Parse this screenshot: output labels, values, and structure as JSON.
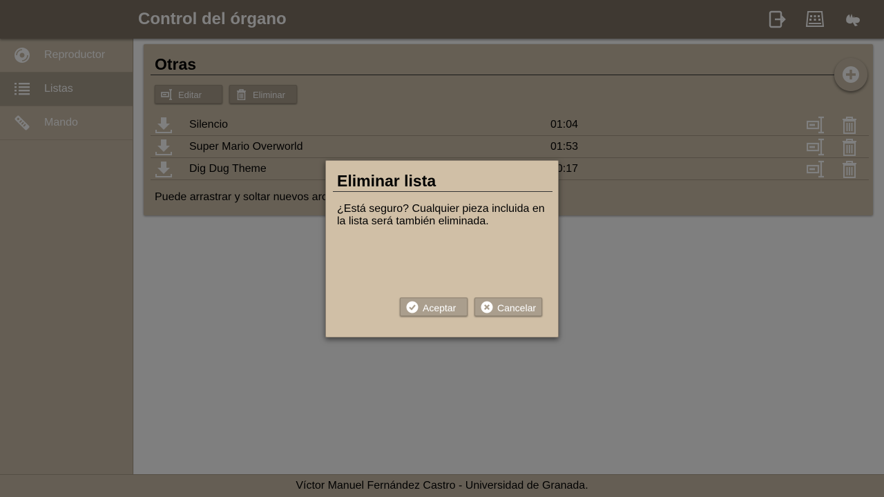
{
  "header": {
    "title": "Control del órgano",
    "icons": [
      "logout-icon",
      "keyboard-icon",
      "sign-language-icon"
    ]
  },
  "sidebar": {
    "items": [
      {
        "label": "Reproductor",
        "icon": "disc-icon"
      },
      {
        "label": "Listas",
        "icon": "list-icon",
        "active": true
      },
      {
        "label": "Mando",
        "icon": "remote-control-icon"
      }
    ]
  },
  "playlist": {
    "title": "Otras",
    "edit_label": "Editar",
    "delete_label": "Eliminar",
    "tracks": [
      {
        "name": "Silencio",
        "duration": "01:04"
      },
      {
        "name": "Super Mario Overworld",
        "duration": "01:53"
      },
      {
        "name": "Dig Dug Theme",
        "duration": "00:17"
      }
    ],
    "hint": "Puede arrastrar y soltar nuevos archivos"
  },
  "dialog": {
    "title": "Eliminar lista",
    "message": "¿Está seguro? Cualquier pieza incluida en la lista será también eliminada.",
    "accept_label": "Aceptar",
    "cancel_label": "Cancelar"
  },
  "footer": {
    "text": "Víctor Manuel Fernández Castro - Universidad de Granada."
  },
  "colors": {
    "header_bg": "#7e7264",
    "sidebar_bg": "#cabda9",
    "card_bg": "#cdbfa9",
    "button_bg": "#aa9e8d",
    "dialog_bg": "#d0bfa6"
  }
}
